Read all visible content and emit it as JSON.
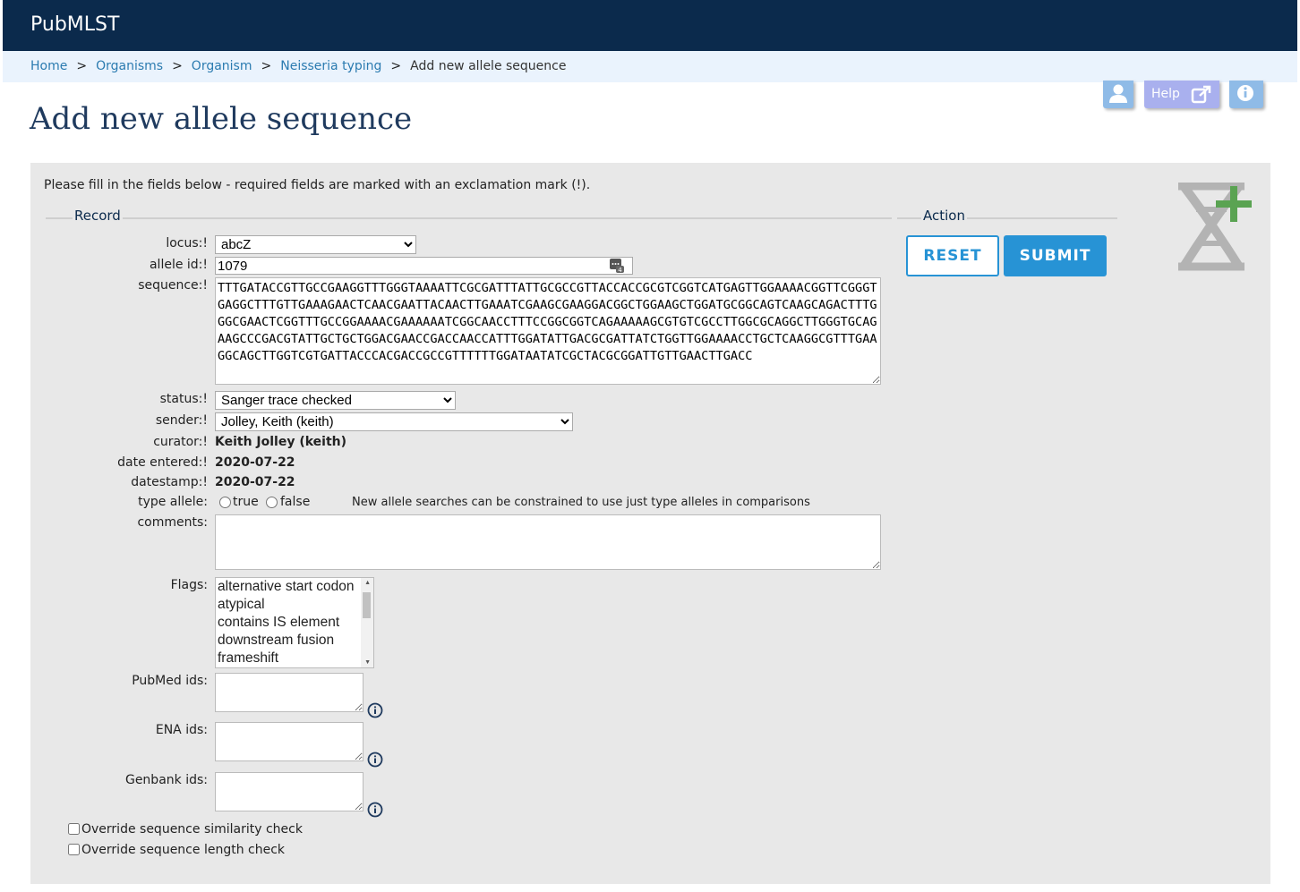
{
  "header": {
    "brand": "PubMLST"
  },
  "breadcrumb": {
    "items": [
      "Home",
      "Organisms",
      "Organism",
      "Neisseria typing"
    ],
    "current": "Add new allele sequence",
    "separator": ">"
  },
  "toolbar": {
    "help_label": "Help"
  },
  "page": {
    "title": "Add new allele sequence",
    "intro": "Please fill in the fields below - required fields are marked with an exclamation mark (!)."
  },
  "record": {
    "legend": "Record",
    "locus_label": "locus:!",
    "locus_value": "abcZ",
    "allele_id_label": "allele id:!",
    "allele_id_value": "1079",
    "sequence_label": "sequence:!",
    "sequence_value": "TTTGATACCGTTGCCGAAGGTTTGGGTAAAATTCGCGATTTATTGCGCCGTTACCACCGCGTCGGTCATGAGTTGGAAAACGGTTCGGGTGAGGCTTTGTTGAAAGAACTCAACGAATTACAACTTGAAATCGAAGCGAAGGACGGCTGGAAGCTGGATGCGGCAGTCAAGCAGACTTTGGGCGAACTCGGTTTGCCGGAAAACGAAAAAATCGGCAACCTTTCCGGCGGTCAGAAAAAGCGTGTCGCCTTGGCGCAGGCTTGGGTGCAGAAGCCCGACGTATTGCTGCTGGACGAACCGACCAACCATTTGGATATTGACGCGATTATCTGGTTGGAAAACCTGCTCAAGGCGTTTGAAGGCAGCTTGGTCGTGATTACCCACGACCGCCGTTTTTTGGATAATATCGCTACGCGGATTGTTGAACTTGACC",
    "status_label": "status:!",
    "status_value": "Sanger trace checked",
    "sender_label": "sender:!",
    "sender_value": "Jolley, Keith (keith)",
    "curator_label": "curator:!",
    "curator_value": "Keith Jolley (keith)",
    "date_entered_label": "date entered:!",
    "date_entered_value": "2020-07-22",
    "datestamp_label": "datestamp:!",
    "datestamp_value": "2020-07-22",
    "type_allele_label": "type allele:",
    "type_allele_true": "true",
    "type_allele_false": "false",
    "type_allele_hint": "New allele searches can be constrained to use just type alleles in comparisons",
    "comments_label": "comments:",
    "flags_label": "Flags:",
    "flags_options": [
      "alternative start codon",
      "atypical",
      "contains IS element",
      "downstream fusion",
      "frameshift"
    ],
    "pubmed_label": "PubMed ids:",
    "ena_label": "ENA ids:",
    "genbank_label": "Genbank ids:",
    "override_similarity": "Override sequence similarity check",
    "override_length": "Override sequence length check"
  },
  "action": {
    "legend": "Action",
    "reset_label": "RESET",
    "submit_label": "SUBMIT"
  },
  "colors": {
    "header_bg": "#0b2a4c",
    "link": "#2b7bb0",
    "accent": "#2793d5",
    "panel_bg": "#e8e8e8"
  },
  "icons": [
    "user-icon",
    "external-link-icon",
    "info-icon",
    "dna-add-icon",
    "ellipsis-icon"
  ]
}
